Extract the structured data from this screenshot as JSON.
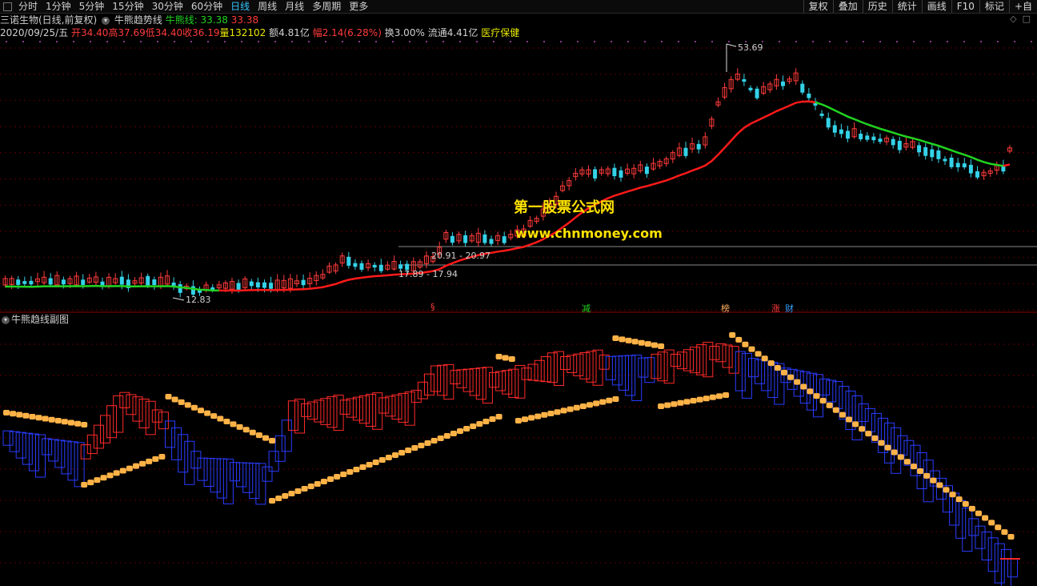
{
  "toolbar": {
    "periods": [
      "分时",
      "1分钟",
      "5分钟",
      "15分钟",
      "30分钟",
      "60分钟",
      "日线",
      "周线",
      "月线",
      "多周期",
      "更多"
    ],
    "active_period": "日线",
    "right_buttons": [
      "复权",
      "叠加",
      "历史",
      "统计",
      "画线",
      "F10",
      "标记",
      "+自"
    ]
  },
  "header": {
    "stock_name": "三诺生物(日线,前复权)",
    "indicator_name": "牛熊趋势线",
    "ma_label": "牛熊线: 33.38",
    "ma_value2": "33.38",
    "date": "2020/09/25/五",
    "open": "开34.40",
    "high": "高37.69",
    "low": "低34.40",
    "close": "收36.19",
    "volume": "量132102",
    "amount": "额4.81亿",
    "change": "幅2.14(6.28%)",
    "turnover": "换3.00%",
    "float": "流通4.41亿",
    "sector": "医疗保健"
  },
  "sub_panel": {
    "title": "牛熊趋线副图"
  },
  "price_labels": {
    "peak": "53.69",
    "low": "12.83",
    "level1": "20.91 - 20.97",
    "level2": "17.89 - 17.94"
  },
  "events": [
    {
      "text": "§",
      "color": "#ff3b3b"
    },
    {
      "text": "减",
      "color": "#21d321"
    },
    {
      "text": "榜",
      "color": "#ffb060"
    },
    {
      "text": "涨",
      "color": "#ff3b3b"
    },
    {
      "text": "财",
      "color": "#34a0ff"
    }
  ],
  "watermark": {
    "line1": "第一股票公式网",
    "line2": "www.chnmoney.com"
  },
  "colors": {
    "up": "#ff3b3b",
    "down": "#34d2e8",
    "bull_line": "#ff1a1a",
    "bear_line": "#21d321",
    "sub_red": "#ff2a2a",
    "sub_blue": "#2a3cff",
    "coin": "#ffb347"
  }
}
